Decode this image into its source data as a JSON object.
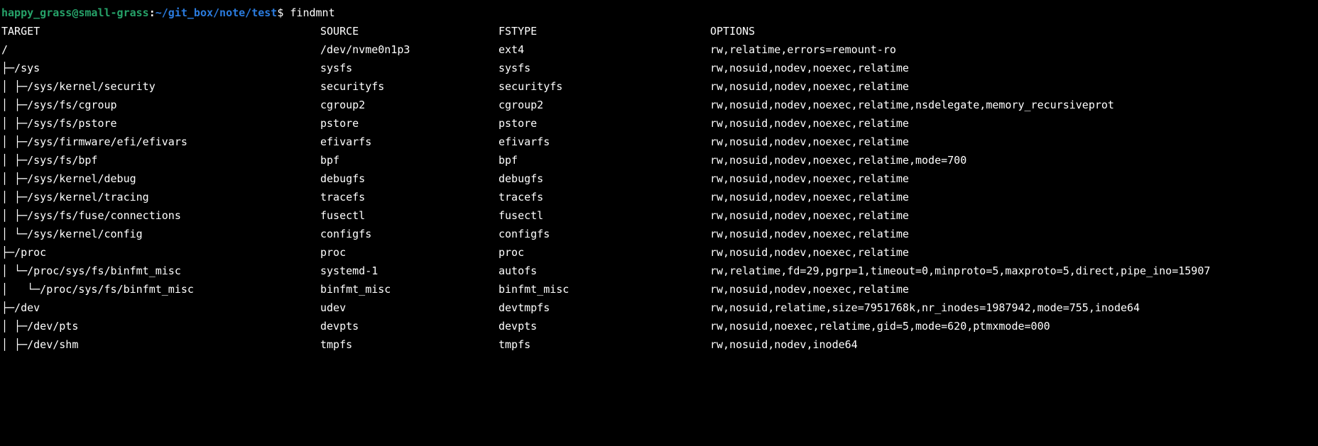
{
  "prompt": {
    "user_host": "happy_grass@small-grass",
    "separator": ":",
    "path": "~/git_box/note/test",
    "symbol": "$ ",
    "command": "findmnt"
  },
  "headers": {
    "target": "TARGET",
    "source": "SOURCE",
    "fstype": "FSTYPE",
    "options": "OPTIONS"
  },
  "rows": [
    {
      "target": "/",
      "source": "/dev/nvme0n1p3",
      "fstype": "ext4",
      "options": "rw,relatime,errors=remount-ro"
    },
    {
      "target": "├─/sys",
      "source": "sysfs",
      "fstype": "sysfs",
      "options": "rw,nosuid,nodev,noexec,relatime"
    },
    {
      "target": "│ ├─/sys/kernel/security",
      "source": "securityfs",
      "fstype": "securityfs",
      "options": "rw,nosuid,nodev,noexec,relatime"
    },
    {
      "target": "│ ├─/sys/fs/cgroup",
      "source": "cgroup2",
      "fstype": "cgroup2",
      "options": "rw,nosuid,nodev,noexec,relatime,nsdelegate,memory_recursiveprot"
    },
    {
      "target": "│ ├─/sys/fs/pstore",
      "source": "pstore",
      "fstype": "pstore",
      "options": "rw,nosuid,nodev,noexec,relatime"
    },
    {
      "target": "│ ├─/sys/firmware/efi/efivars",
      "source": "efivarfs",
      "fstype": "efivarfs",
      "options": "rw,nosuid,nodev,noexec,relatime"
    },
    {
      "target": "│ ├─/sys/fs/bpf",
      "source": "bpf",
      "fstype": "bpf",
      "options": "rw,nosuid,nodev,noexec,relatime,mode=700"
    },
    {
      "target": "│ ├─/sys/kernel/debug",
      "source": "debugfs",
      "fstype": "debugfs",
      "options": "rw,nosuid,nodev,noexec,relatime"
    },
    {
      "target": "│ ├─/sys/kernel/tracing",
      "source": "tracefs",
      "fstype": "tracefs",
      "options": "rw,nosuid,nodev,noexec,relatime"
    },
    {
      "target": "│ ├─/sys/fs/fuse/connections",
      "source": "fusectl",
      "fstype": "fusectl",
      "options": "rw,nosuid,nodev,noexec,relatime"
    },
    {
      "target": "│ └─/sys/kernel/config",
      "source": "configfs",
      "fstype": "configfs",
      "options": "rw,nosuid,nodev,noexec,relatime"
    },
    {
      "target": "├─/proc",
      "source": "proc",
      "fstype": "proc",
      "options": "rw,nosuid,nodev,noexec,relatime"
    },
    {
      "target": "│ └─/proc/sys/fs/binfmt_misc",
      "source": "systemd-1",
      "fstype": "autofs",
      "options": "rw,relatime,fd=29,pgrp=1,timeout=0,minproto=5,maxproto=5,direct,pipe_ino=15907"
    },
    {
      "target": "│   └─/proc/sys/fs/binfmt_misc",
      "source": "binfmt_misc",
      "fstype": "binfmt_misc",
      "options": "rw,nosuid,nodev,noexec,relatime"
    },
    {
      "target": "├─/dev",
      "source": "udev",
      "fstype": "devtmpfs",
      "options": "rw,nosuid,relatime,size=7951768k,nr_inodes=1987942,mode=755,inode64"
    },
    {
      "target": "│ ├─/dev/pts",
      "source": "devpts",
      "fstype": "devpts",
      "options": "rw,nosuid,noexec,relatime,gid=5,mode=620,ptmxmode=000"
    },
    {
      "target": "│ ├─/dev/shm",
      "source": "tmpfs",
      "fstype": "tmpfs",
      "options": "rw,nosuid,nodev,inode64"
    }
  ],
  "colors": {
    "background": "#000000",
    "foreground": "#ffffff",
    "prompt_user": "#26a269",
    "prompt_path": "#2a7bde"
  }
}
